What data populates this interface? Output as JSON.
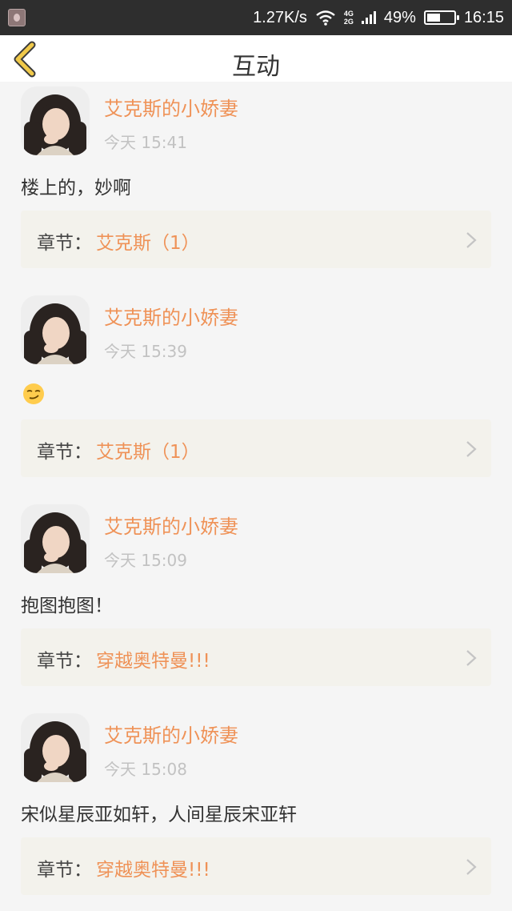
{
  "status_bar": {
    "speed": "1.27K/s",
    "net_top": "4G",
    "net_bottom": "2G",
    "battery": "49%",
    "battery_level": 0.49,
    "time": "16:15"
  },
  "header": {
    "title": "互动"
  },
  "colors": {
    "accent": "#ef9257",
    "back_icon": "#f0c94a",
    "status_bar_bg": "#2e2e2e",
    "chapter_bg": "#f3f2ec"
  },
  "icons": {
    "back": "chevron-left-icon",
    "chapter_arrow": "chevron-right-icon",
    "emoji": "smirk-emoji-icon"
  },
  "posts": [
    {
      "username": "艾克斯的小娇妻",
      "time": "今天 15:41",
      "comment": "楼上的，妙啊",
      "chapter_prefix": "章节：",
      "chapter": "艾克斯（1）"
    },
    {
      "username": "艾克斯的小娇妻",
      "time": "今天 15:39",
      "comment": "",
      "chapter_prefix": "章节：",
      "chapter": "艾克斯（1）"
    },
    {
      "username": "艾克斯的小娇妻",
      "time": "今天 15:09",
      "comment": "抱图抱图！",
      "chapter_prefix": "章节：",
      "chapter": "穿越奥特曼!!!"
    },
    {
      "username": "艾克斯的小娇妻",
      "time": "今天 15:08",
      "comment": "宋似星辰亚如轩，人间星辰宋亚轩",
      "chapter_prefix": "章节：",
      "chapter": "穿越奥特曼!!!"
    }
  ]
}
